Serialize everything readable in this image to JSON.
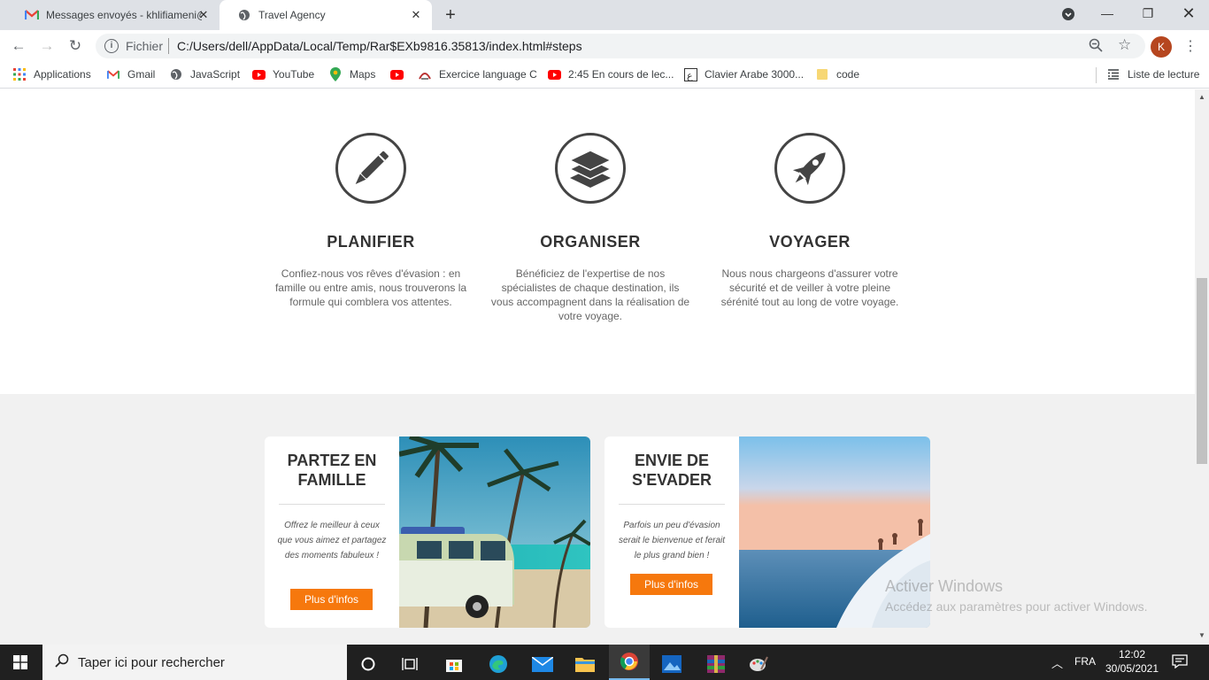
{
  "browser": {
    "tabs": [
      {
        "title": "Messages envoyés - khlifiameni@",
        "icon": "gmail-icon"
      },
      {
        "title": "Travel Agency",
        "icon": "globe-icon"
      }
    ],
    "new_tab": "+",
    "url_scheme_label": "Fichier",
    "url": "C:/Users/dell/AppData/Local/Temp/Rar$EXb9816.35813/index.html#steps",
    "avatar_letter": "K",
    "bookmarks": [
      {
        "label": "Applications",
        "icon": "apps-grid-icon"
      },
      {
        "label": "Gmail",
        "icon": "gmail-icon"
      },
      {
        "label": "JavaScript",
        "icon": "globe-icon"
      },
      {
        "label": "YouTube",
        "icon": "youtube-icon"
      },
      {
        "label": "Maps",
        "icon": "maps-pin-icon"
      },
      {
        "label": "",
        "icon": "youtube-icon"
      },
      {
        "label": "Exercice language C",
        "icon": "site-icon"
      },
      {
        "label": "2:45 En cours de lec...",
        "icon": "youtube-icon"
      },
      {
        "label": "Clavier Arabe 3000...",
        "icon": "site-icon"
      },
      {
        "label": "code",
        "icon": "folder-icon"
      }
    ],
    "reading_list": "Liste de lecture"
  },
  "steps": [
    {
      "title": "PLANIFIER",
      "icon": "pencil-icon",
      "text": "Confiez-nous vos rêves d'évasion : en famille ou entre amis, nous trouverons la formule qui comblera vos attentes."
    },
    {
      "title": "ORGANISER",
      "icon": "layers-icon",
      "text": "Bénéficiez de l'expertise de nos spécialistes de chaque destination, ils vous accompagnent dans la réalisation de votre voyage."
    },
    {
      "title": "VOYAGER",
      "icon": "rocket-icon",
      "text": "Nous nous chargeons d'assurer votre sécurité et de veiller à votre pleine sérénité tout au long de votre voyage."
    }
  ],
  "cards": [
    {
      "title": "PARTEZ EN FAMILLE",
      "text": "Offrez le meilleur à ceux que vous aimez et partagez des moments fabuleux !",
      "button": "Plus d'infos"
    },
    {
      "title": "ENVIE DE S'EVADER",
      "text": "Parfois un peu d'évasion serait le bienvenue et ferait le plus grand bien !",
      "button": "Plus d'infos"
    }
  ],
  "watermark": {
    "title": "Activer Windows",
    "subtitle": "Accédez aux paramètres pour activer Windows."
  },
  "taskbar": {
    "search_placeholder": "Taper ici pour rechercher",
    "language": "FRA",
    "time": "12:02",
    "date": "30/05/2021"
  },
  "colors": {
    "accent": "#f6780d",
    "icon_stroke": "#444444",
    "section_bg": "#f1f1f1"
  }
}
